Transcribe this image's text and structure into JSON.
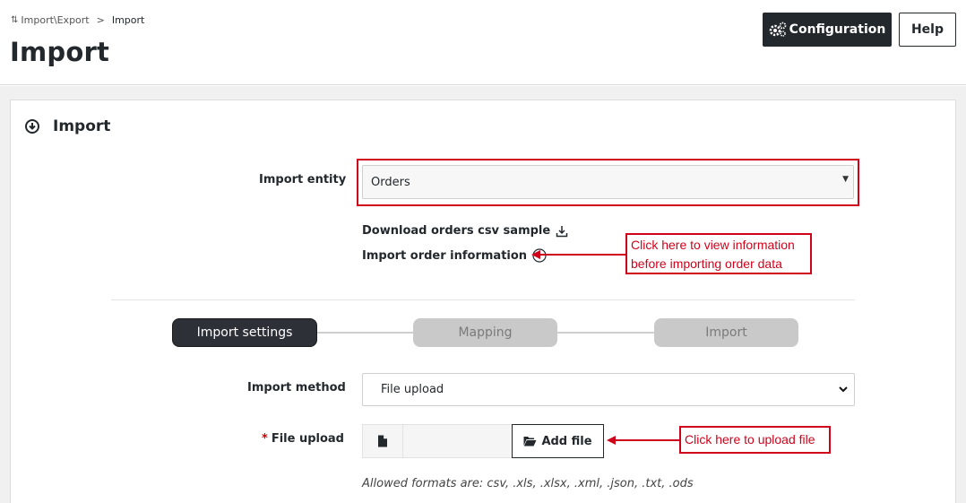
{
  "breadcrumb": {
    "parent": "Import\\Export",
    "separator": ">",
    "current": "Import"
  },
  "page": {
    "title": "Import"
  },
  "header_buttons": {
    "configuration": "Configuration",
    "help": "Help"
  },
  "section": {
    "title": "Import"
  },
  "form": {
    "entity_label": "Import entity",
    "entity_value": "Orders",
    "download_link": "Download orders csv sample",
    "info_link": "Import order information",
    "method_label": "Import method",
    "method_value": "File upload",
    "file_label": "File upload",
    "required_mark": "*",
    "add_file": "Add file",
    "formats_note": "Allowed formats are: csv, .xls, .xlsx, .xml, .json, .txt, .ods"
  },
  "steps": [
    {
      "label": "Import settings",
      "state": "active"
    },
    {
      "label": "Mapping",
      "state": "inactive"
    },
    {
      "label": "Import",
      "state": "inactive"
    }
  ],
  "annotations": {
    "info_callout_line1": "Click here to view information",
    "info_callout_line2": "before importing order data",
    "upload_callout": "Click here to upload file"
  },
  "colors": {
    "accent_dark": "#23282d",
    "annotation_red": "#d0021b",
    "step_inactive": "#c9c9c9"
  },
  "icons": [
    "import-export-icon",
    "gears-icon",
    "circle-arrow-down-icon",
    "download-icon",
    "info-circle-icon",
    "file-icon",
    "folder-open-icon",
    "chevron-down-icon"
  ]
}
